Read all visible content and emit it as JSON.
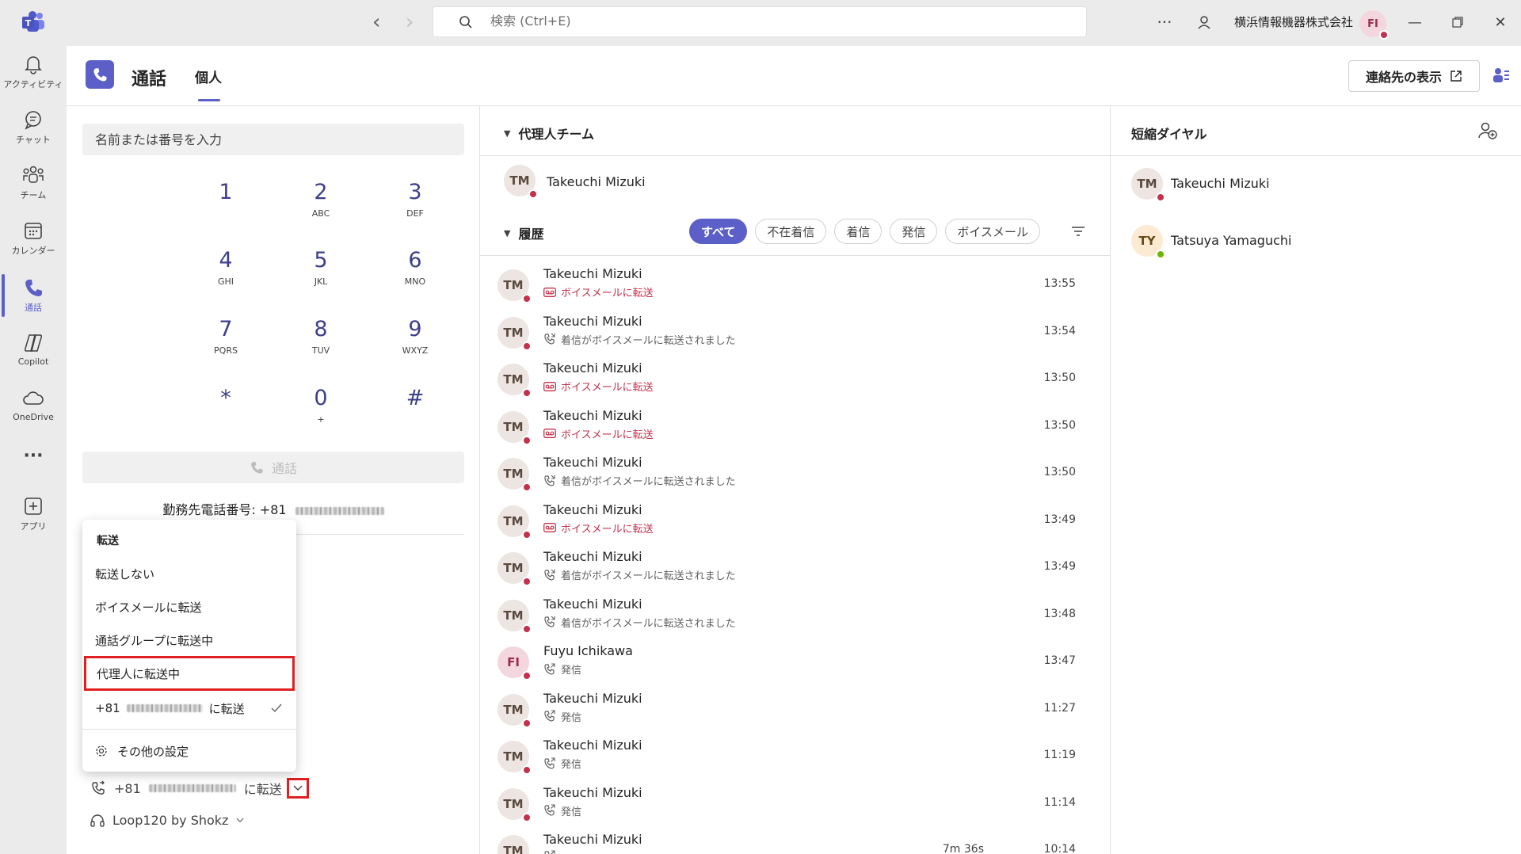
{
  "titlebar": {
    "search_placeholder": "検索 (Ctrl+E)",
    "org_name": "横浜情報機器株式会社",
    "user_initials": "FI"
  },
  "rail": [
    {
      "label": "アクティビティ",
      "icon": "bell-icon"
    },
    {
      "label": "チャット",
      "icon": "chat-icon"
    },
    {
      "label": "チーム",
      "icon": "teams-icon"
    },
    {
      "label": "カレンダー",
      "icon": "calendar-icon"
    },
    {
      "label": "通話",
      "icon": "phone-icon",
      "active": true
    },
    {
      "label": "Copilot",
      "icon": "copilot-icon"
    },
    {
      "label": "OneDrive",
      "icon": "cloud-icon"
    },
    {
      "label": "···",
      "icon": "more-icon"
    },
    {
      "label": "アプリ",
      "icon": "add-app-icon"
    }
  ],
  "header": {
    "title": "通話",
    "tab": "個人",
    "contacts_button": "連絡先の表示"
  },
  "dialpad": {
    "input_placeholder": "名前または番号を入力",
    "keys": [
      {
        "digit": "1",
        "sub": ""
      },
      {
        "digit": "2",
        "sub": "ABC"
      },
      {
        "digit": "3",
        "sub": "DEF"
      },
      {
        "digit": "4",
        "sub": "GHI"
      },
      {
        "digit": "5",
        "sub": "JKL"
      },
      {
        "digit": "6",
        "sub": "MNO"
      },
      {
        "digit": "7",
        "sub": "PQRS"
      },
      {
        "digit": "8",
        "sub": "TUV"
      },
      {
        "digit": "9",
        "sub": "WXYZ"
      },
      {
        "digit": "*",
        "sub": ""
      },
      {
        "digit": "0",
        "sub": "+"
      },
      {
        "digit": "#",
        "sub": ""
      }
    ],
    "call_label": "通話",
    "work_number_label": "勤務先電話番号: +81"
  },
  "forward_menu": {
    "header": "転送",
    "items": [
      "転送しない",
      "ボイスメールに転送",
      "通話グループに転送中",
      "代理人に転送中"
    ],
    "number_prefix": "+81",
    "number_suffix": "に転送",
    "settings": "その他の設定"
  },
  "status": {
    "forward_prefix": "+81",
    "forward_suffix": "に転送",
    "device": "Loop120 by Shokz"
  },
  "delegates": {
    "title": "代理人チーム",
    "member": {
      "initials": "TM",
      "name": "Takeuchi Mizuki",
      "presence": "busy"
    }
  },
  "history": {
    "title": "履歴",
    "filters": [
      "すべて",
      "不在着信",
      "着信",
      "発信",
      "ボイスメール"
    ],
    "rows": [
      {
        "initials": "TM",
        "name": "Takeuchi Mizuki",
        "sub": "ボイスメールに転送",
        "kind": "voicemail",
        "time": "13:55"
      },
      {
        "initials": "TM",
        "name": "Takeuchi Mizuki",
        "sub": "着信がボイスメールに転送されました",
        "kind": "redirect",
        "time": "13:54"
      },
      {
        "initials": "TM",
        "name": "Takeuchi Mizuki",
        "sub": "ボイスメールに転送",
        "kind": "voicemail",
        "time": "13:50"
      },
      {
        "initials": "TM",
        "name": "Takeuchi Mizuki",
        "sub": "ボイスメールに転送",
        "kind": "voicemail",
        "time": "13:50"
      },
      {
        "initials": "TM",
        "name": "Takeuchi Mizuki",
        "sub": "着信がボイスメールに転送されました",
        "kind": "redirect",
        "time": "13:50"
      },
      {
        "initials": "TM",
        "name": "Takeuchi Mizuki",
        "sub": "ボイスメールに転送",
        "kind": "voicemail",
        "time": "13:49"
      },
      {
        "initials": "TM",
        "name": "Takeuchi Mizuki",
        "sub": "着信がボイスメールに転送されました",
        "kind": "redirect",
        "time": "13:49"
      },
      {
        "initials": "TM",
        "name": "Takeuchi Mizuki",
        "sub": "着信がボイスメールに転送されました",
        "kind": "redirect",
        "time": "13:48"
      },
      {
        "initials": "FI",
        "name": "Fuyu Ichikawa",
        "sub": "発信",
        "kind": "outgoing",
        "time": "13:47"
      },
      {
        "initials": "TM",
        "name": "Takeuchi Mizuki",
        "sub": "発信",
        "kind": "outgoing",
        "time": "11:27"
      },
      {
        "initials": "TM",
        "name": "Takeuchi Mizuki",
        "sub": "発信",
        "kind": "outgoing",
        "time": "11:19"
      },
      {
        "initials": "TM",
        "name": "Takeuchi Mizuki",
        "sub": "発信",
        "kind": "outgoing",
        "time": "11:14"
      },
      {
        "initials": "TM",
        "name": "Takeuchi Mizuki",
        "sub": "",
        "kind": "outgoing",
        "time": "10:14",
        "duration": "7m 36s"
      }
    ]
  },
  "speed_dial": {
    "title": "短縮ダイヤル",
    "contacts": [
      {
        "initials": "TM",
        "name": "Takeuchi Mizuki",
        "presence": "busy"
      },
      {
        "initials": "TY",
        "name": "Tatsuya Yamaguchi",
        "presence": "available"
      }
    ]
  },
  "colors": {
    "accent": "#5b5fc7",
    "busy": "#c4314b",
    "available": "#6bb700",
    "highlight": "#e02020"
  }
}
